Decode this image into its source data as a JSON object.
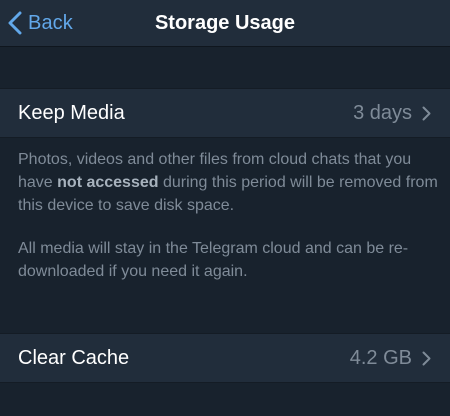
{
  "navbar": {
    "back_label": "Back",
    "title": "Storage Usage"
  },
  "keep_media": {
    "label": "Keep Media",
    "value": "3 days",
    "note_before": "Photos, videos and other files from cloud chats that you have ",
    "note_bold": "not accessed",
    "note_after": " during this period will be removed from this device to save disk space.",
    "note_2": "All media will stay in the Telegram cloud and can be re-downloaded if you need it again."
  },
  "clear_cache": {
    "label": "Clear Cache",
    "value": "4.2 GB"
  },
  "colors": {
    "background": "#18222d",
    "cell": "#212d3b",
    "accent": "#62a8ea",
    "secondary_text": "#7f8b98"
  },
  "icons": {
    "back": "chevron-left-icon",
    "disclosure": "chevron-right-icon"
  }
}
